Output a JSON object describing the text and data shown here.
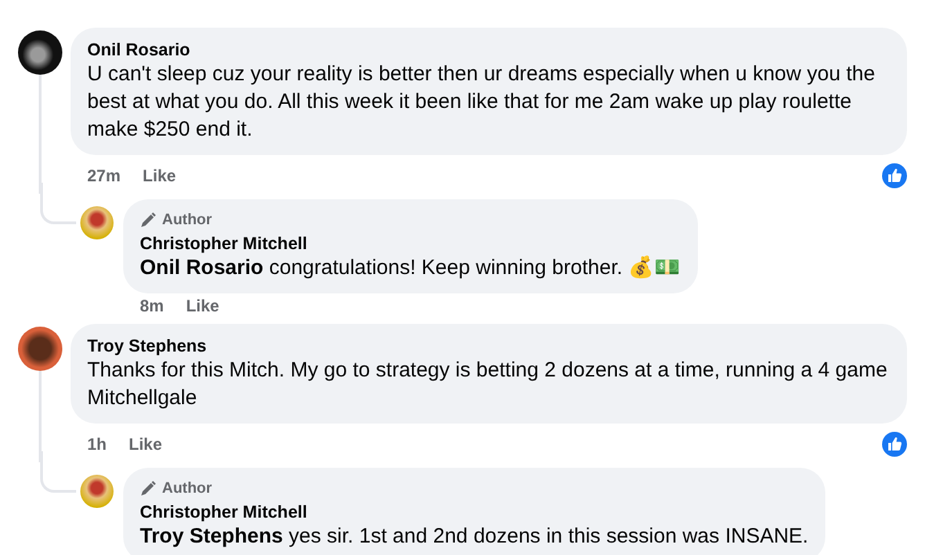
{
  "comments": [
    {
      "author": "Onil Rosario",
      "text": "U can't sleep cuz your reality is better then ur dreams especially when u know you the best at what you do. All this week it been like that for me 2am wake up play roulette make $250 end it.",
      "time": "27m",
      "like_label": "Like",
      "liked": true,
      "replies": [
        {
          "badge": "Author",
          "author": "Christopher Mitchell",
          "text": "**Onil Rosario** congratulations! Keep winning brother. 💰💵",
          "time": "8m",
          "like_label": "Like"
        }
      ]
    },
    {
      "author": "Troy Stephens",
      "text": "Thanks for this Mitch. My go to strategy is betting 2 dozens at a time, running a 4 game Mitchellgale",
      "time": "1h",
      "like_label": "Like",
      "liked": true,
      "replies": [
        {
          "badge": "Author",
          "author": "Christopher Mitchell",
          "text": "**Troy Stephens** yes sir. 1st and 2nd dozens in this session was INSANE."
        }
      ]
    }
  ]
}
